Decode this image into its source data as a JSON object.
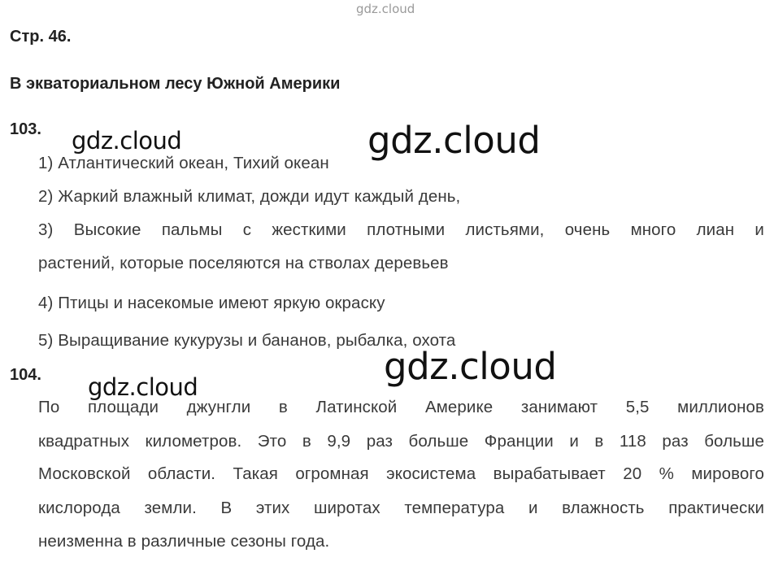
{
  "watermarks": {
    "top": "gdz.cloud",
    "small_1": "gdz.cloud",
    "large_1": "gdz.cloud",
    "large_2": "gdz.cloud",
    "small_2": "gdz.cloud"
  },
  "page_label": "Стр. 46.",
  "section_title": "В экваториальном лесу Южной Америки",
  "task_103": {
    "number": "103.",
    "lines": [
      "1) Атлантический океан, Тихий океан",
      "2) Жаркий влажный климат, дожди идут каждый день,",
      "3) Высокие пальмы с жесткими плотными листьями, очень много лиан и",
      "растений, которые поселяются на стволах деревьев",
      "4) Птицы и насекомые имеют яркую окраску",
      "5) Выращивание кукурузы и бананов, рыбалка, охота"
    ]
  },
  "task_104": {
    "number": "104.",
    "lines": [
      "По площади джунгли в Латинской Америке занимают 5,5 миллионов",
      "квадратных километров. Это в 9,9 раз больше Франции и в 118 раз больше",
      "Московской области. Такая огромная экосистема вырабатывает 20 % мирового",
      "кислорода земли. В этих широтах температура и влажность практически",
      "неизменна в различные сезоны года."
    ]
  }
}
